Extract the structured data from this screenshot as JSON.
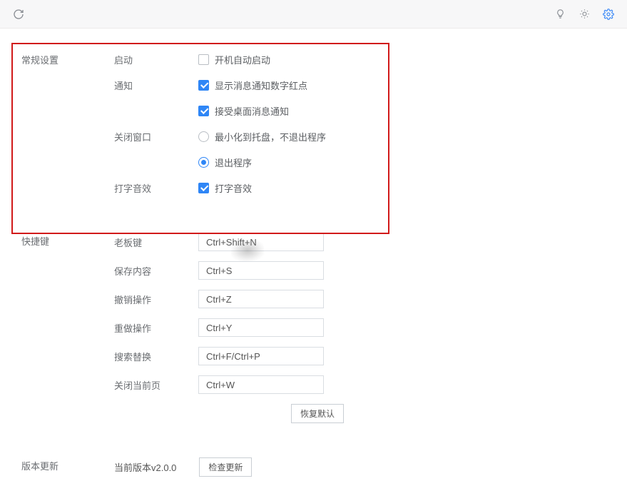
{
  "sections": {
    "general": {
      "title": "常规设置",
      "startup": {
        "label": "启动",
        "options": {
          "auto": "开机自动启动"
        }
      },
      "notify": {
        "label": "通知",
        "options": {
          "badge": "显示消息通知数字红点",
          "desktop": "接受桌面消息通知"
        }
      },
      "close_window": {
        "label": "关闭窗口",
        "options": {
          "minimize": "最小化到托盘，不退出程序",
          "exit": "退出程序"
        }
      },
      "typing_sound": {
        "label": "打字音效",
        "options": {
          "enabled": "打字音效"
        }
      }
    },
    "hotkeys": {
      "title": "快捷键",
      "rows": {
        "boss": {
          "label": "老板键",
          "value": "Ctrl+Shift+N"
        },
        "save": {
          "label": "保存内容",
          "value": "Ctrl+S"
        },
        "undo": {
          "label": "撤销操作",
          "value": "Ctrl+Z"
        },
        "redo": {
          "label": "重做操作",
          "value": "Ctrl+Y"
        },
        "search": {
          "label": "搜索替换",
          "value": "Ctrl+F/Ctrl+P"
        },
        "close_tab": {
          "label": "关闭当前页",
          "value": "Ctrl+W"
        }
      },
      "reset_button": "恢复默认"
    },
    "update": {
      "title": "版本更新",
      "current_version": "当前版本v2.0.0",
      "check_button": "检查更新"
    }
  }
}
